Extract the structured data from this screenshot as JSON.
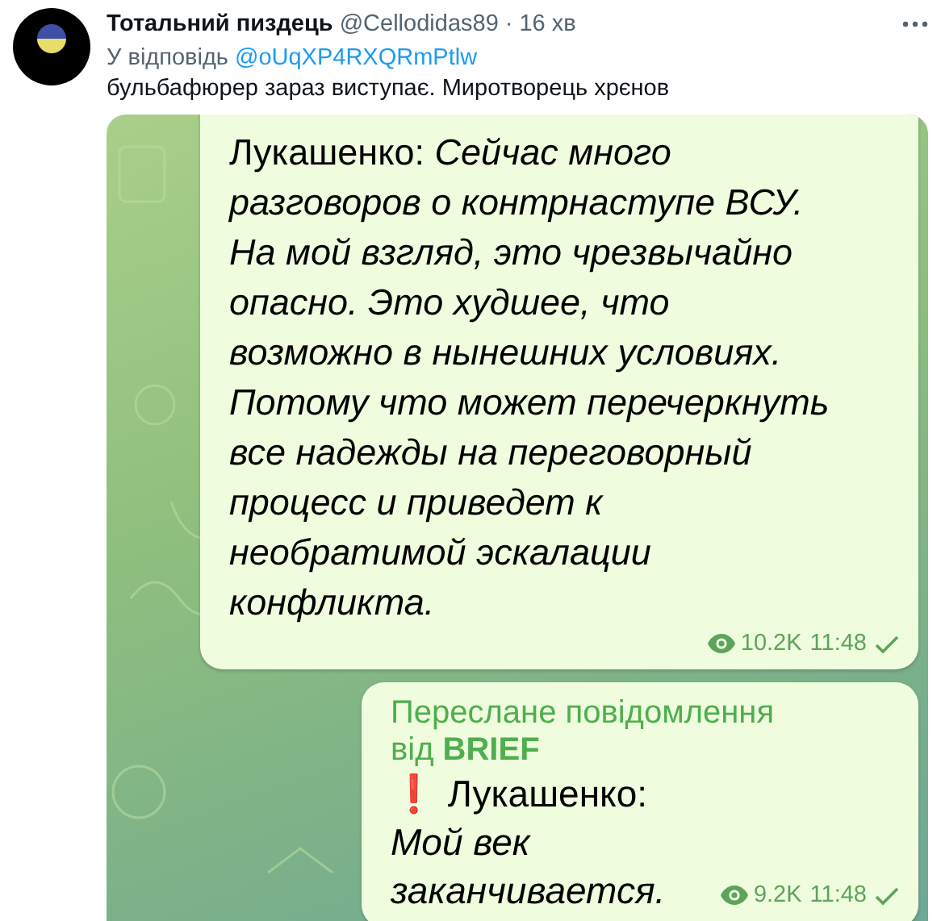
{
  "tweet": {
    "author": "Тотальний пиздець",
    "handle": "@Cellodidas89",
    "separator": "·",
    "time": "16 хв",
    "reply_prefix": "У відповідь",
    "reply_to": "@oUqXP4RXQRmPtlw",
    "text": "бульбафюрер зараз виступає. Миротворець хрєнов"
  },
  "chat": {
    "messages": [
      {
        "kind": "plain",
        "text": "Лукашенко: *Сейчас много разговоров о контрнаступе ВСУ. На мой взгляд, это чрезвычайно опасно. Это худшее, что возможно в нынешних условиях. Потому что может перечеркнуть все надежды на переговорный процесс и приведет к необратимой эскалации конфликта.*",
        "views": "10.2K",
        "time": "11:48"
      },
      {
        "kind": "forwarded",
        "forward_label": "Переслане повідомлення",
        "forward_from": "від **BRIEF**",
        "text": "❗ Лукашенко: *Мой век заканчивается.*",
        "views": "9.2K",
        "time": "11:48"
      }
    ]
  }
}
